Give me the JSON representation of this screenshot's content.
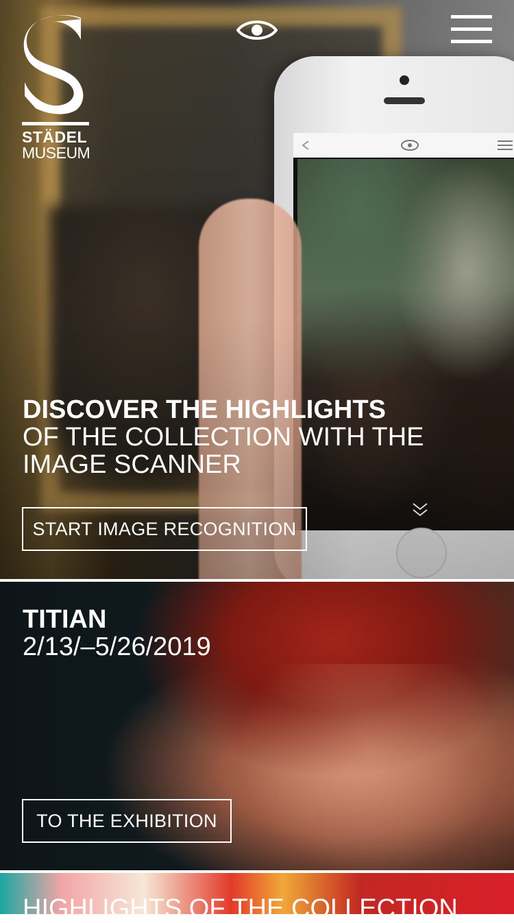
{
  "logo": {
    "name": "STÄDEL",
    "sub": "MUSEUM"
  },
  "hero": {
    "title_strong": "DISCOVER THE HIGHLIGHTS",
    "title_line2": "OF THE COLLECTION WITH THE",
    "title_line3": "IMAGE SCANNER",
    "button_label": "START IMAGE RECOGNITION"
  },
  "exhibition": {
    "name": "TITIAN",
    "dates": "2/13/–5/26/2019",
    "button_label": "TO THE EXHIBITION"
  },
  "highlights": {
    "title": "HIGHLIGHTS OF THE COLLECTION"
  },
  "icons": {
    "eye": "eye-icon",
    "menu": "hamburger-menu-icon",
    "scroll": "double-chevron-down-icon"
  }
}
